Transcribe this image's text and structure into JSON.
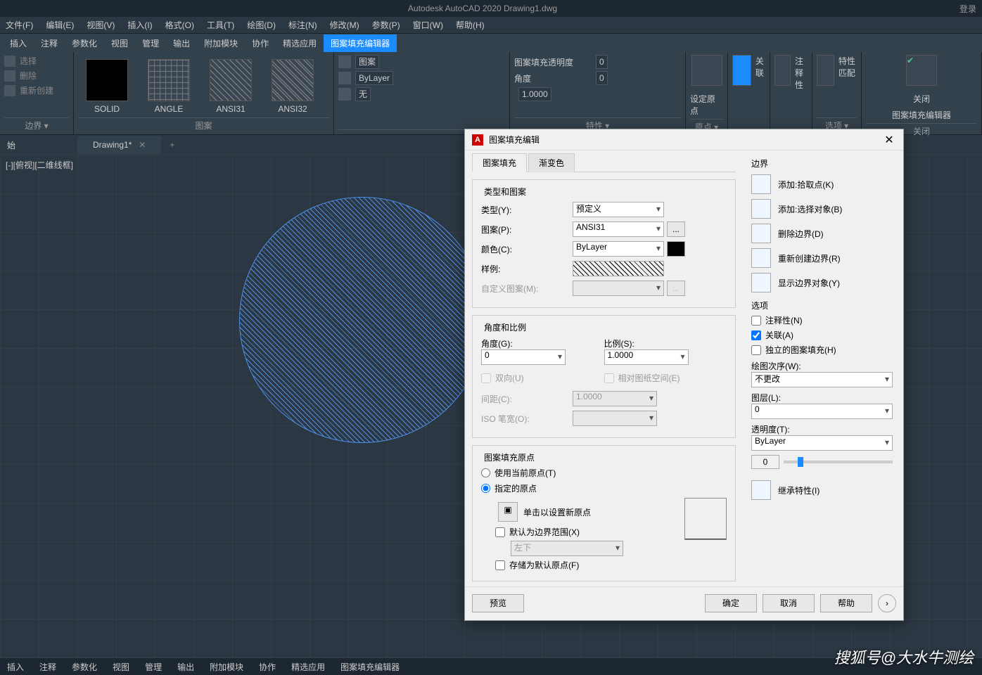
{
  "title": "Autodesk AutoCAD 2020  Drawing1.dwg",
  "login": "登录",
  "menus": [
    "文件(F)",
    "编辑(E)",
    "视图(V)",
    "插入(I)",
    "格式(O)",
    "工具(T)",
    "绘图(D)",
    "标注(N)",
    "修改(M)",
    "参数(P)",
    "窗口(W)",
    "帮助(H)"
  ],
  "tabs": [
    "插入",
    "注释",
    "参数化",
    "视图",
    "管理",
    "输出",
    "附加模块",
    "协作",
    "精选应用",
    "图案填充编辑器"
  ],
  "activeTab": "图案填充编辑器",
  "panel1": {
    "items": [
      "选择",
      "删除",
      "重新创建"
    ],
    "label": "边界 ▾"
  },
  "panel2": {
    "swatches": [
      {
        "n": "SOLID"
      },
      {
        "n": "ANGLE"
      },
      {
        "n": "ANSI31"
      },
      {
        "n": "ANSI32"
      }
    ],
    "label": "图案"
  },
  "panel3": {
    "r1": "图案",
    "r2": "ByLayer",
    "r3": "无",
    "label": ""
  },
  "panel4": {
    "r1l": "图案填充透明度",
    "r1v": "0",
    "r2l": "角度",
    "r2v": "0",
    "r3v": "1.0000",
    "label": "特性 ▾"
  },
  "p5": {
    "t": "设定原点",
    "label": "原点 ▾"
  },
  "p6": {
    "t": "关联"
  },
  "p7": {
    "t": "注释性"
  },
  "p8": {
    "t": "特性匹配",
    "label": "选项 ▾"
  },
  "p9": {
    "t": "关闭",
    "t2": "图案填充编辑器",
    "label": "关闭"
  },
  "filetab": {
    "name": "Drawing1*"
  },
  "start": "始",
  "viewlabel": "[-][俯视][二维线框]",
  "bottomtabs": [
    "插入",
    "注释",
    "参数化",
    "视图",
    "管理",
    "输出",
    "附加模块",
    "协作",
    "精选应用",
    "图案填充编辑器"
  ],
  "dlg": {
    "title": "图案填充编辑",
    "subtabs": [
      "图案填充",
      "渐变色"
    ],
    "g1": {
      "h": "类型和图案",
      "typeL": "类型(Y):",
      "typeV": "预定义",
      "patL": "图案(P):",
      "patV": "ANSI31",
      "colL": "颜色(C):",
      "colV": "ByLayer",
      "sampleL": "样例:",
      "customL": "自定义图案(M):"
    },
    "g2": {
      "h": "角度和比例",
      "angL": "角度(G):",
      "angV": "0",
      "sclL": "比例(S):",
      "sclV": "1.0000",
      "dblL": "双向(U)",
      "relL": "相对图纸空间(E)",
      "spcL": "间距(C):",
      "spcV": "1.0000",
      "isoL": "ISO 笔宽(O):"
    },
    "g3": {
      "h": "图案填充原点",
      "r1": "使用当前原点(T)",
      "r2": "指定的原点",
      "b1": "单击以设置新原点",
      "cb1": "默认为边界范围(X)",
      "dd": "左下",
      "cb2": "存储为默认原点(F)"
    },
    "right": {
      "gB": {
        "h": "边界",
        "b1": "添加:拾取点(K)",
        "b2": "添加:选择对象(B)",
        "b3": "删除边界(D)",
        "b4": "重新创建边界(R)",
        "b5": "显示边界对象(Y)"
      },
      "gO": {
        "h": "选项",
        "c1": "注释性(N)",
        "c2": "关联(A)",
        "c3": "独立的图案填充(H)",
        "drawL": "绘图次序(W):",
        "drawV": "不更改",
        "layL": "图层(L):",
        "layV": "0",
        "trL": "透明度(T):",
        "trV": "ByLayer",
        "trn": "0"
      },
      "inh": "继承特性(I)"
    },
    "footer": {
      "preview": "预览",
      "ok": "确定",
      "cancel": "取消",
      "help": "帮助"
    }
  },
  "watermark": "搜狐号@大水牛测绘"
}
